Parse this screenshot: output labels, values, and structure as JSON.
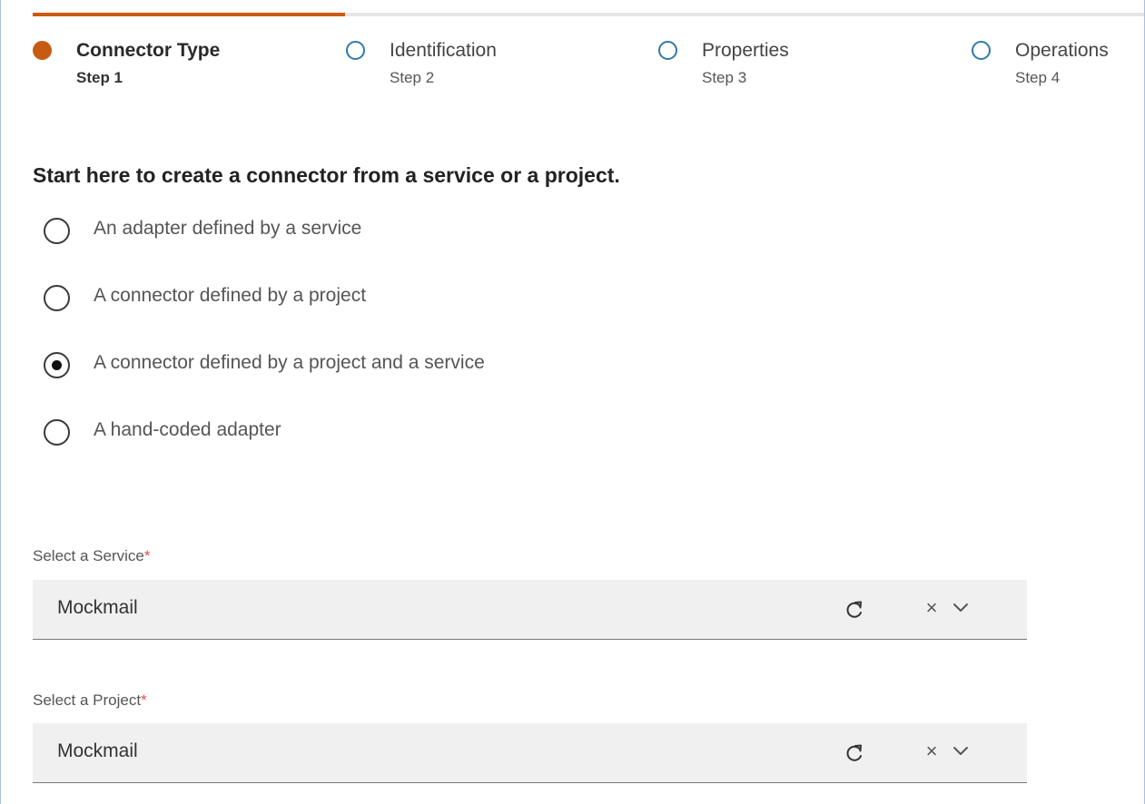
{
  "colors": {
    "accent": "#c75b12",
    "todo_ring": "#2f7aa8",
    "required": "#d9534f"
  },
  "stepper": {
    "progress": 0.25,
    "steps": [
      {
        "name": "Connector Type",
        "sub": "Step 1",
        "state": "active"
      },
      {
        "name": "Identification",
        "sub": "Step 2",
        "state": "todo"
      },
      {
        "name": "Properties",
        "sub": "Step 3",
        "state": "todo"
      },
      {
        "name": "Operations",
        "sub": "Step 4",
        "state": "todo"
      }
    ]
  },
  "heading": "Start here to create a connector from a service or a project.",
  "options": [
    {
      "label": "An adapter defined by a service",
      "checked": false
    },
    {
      "label": "A connector defined by a project",
      "checked": false
    },
    {
      "label": "A connector defined by a project and a service",
      "checked": true
    },
    {
      "label": "A hand-coded adapter",
      "checked": false
    }
  ],
  "service": {
    "label": "Select a Service",
    "required": "*",
    "value": "Mockmail",
    "icons": [
      "refresh-icon",
      "clear-icon",
      "chevron-down-icon"
    ]
  },
  "project": {
    "label": "Select a Project",
    "required": "*",
    "value": "Mockmail",
    "icons": [
      "refresh-icon",
      "clear-icon",
      "chevron-down-icon"
    ]
  },
  "clear_glyph": "×"
}
